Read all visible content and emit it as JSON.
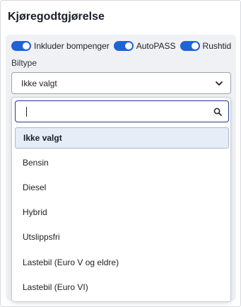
{
  "section_title": "Kjøregodtgjørelse",
  "toggles": [
    {
      "label": "Inkluder bompenger",
      "on": true
    },
    {
      "label": "AutoPASS",
      "on": true
    },
    {
      "label": "Rushtid",
      "on": true
    }
  ],
  "biltype": {
    "label": "Biltype",
    "selected": "Ikke valgt",
    "search_value": "",
    "options": [
      "Ikke valgt",
      "Bensin",
      "Diesel",
      "Hybrid",
      "Utslippsfri",
      "Lastebil (Euro V og eldre)",
      "Lastebil (Euro VI)"
    ]
  },
  "colors": {
    "toggle_on": "#1f63d6",
    "search_border": "#1f3a8a",
    "selected_option_bg": "#e7edf7"
  },
  "icons": {
    "select": "chevron-down-icon",
    "search": "search-icon"
  }
}
